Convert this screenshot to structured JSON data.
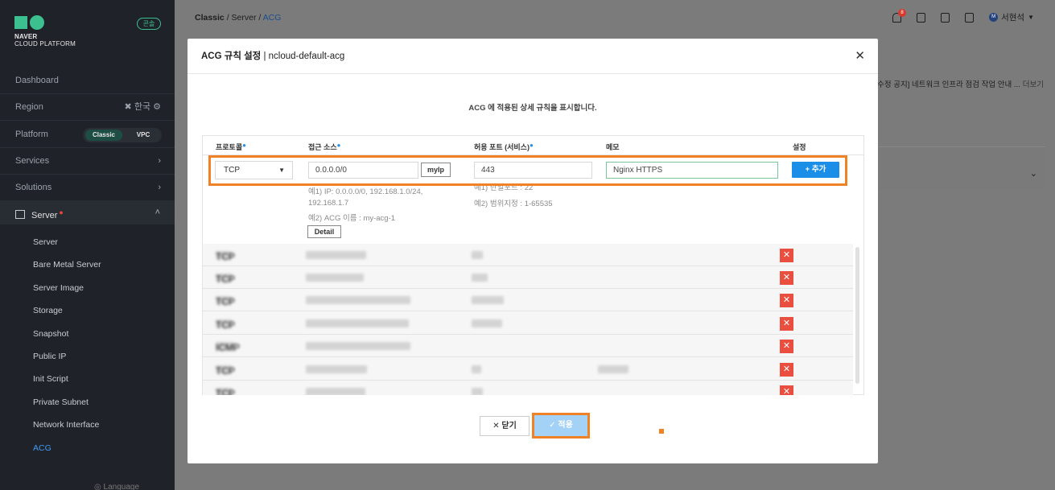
{
  "sidebar": {
    "brand_line1": "NAVER",
    "brand_line2": "CLOUD PLATFORM",
    "badge": "콘솔",
    "dashboard": "Dashboard",
    "region_label": "Region",
    "region_value": "한국",
    "platform_label": "Platform",
    "platform_options": [
      "Classic",
      "VPC"
    ],
    "services": "Services",
    "solutions": "Solutions",
    "server_section": "Server",
    "server_items": [
      "Server",
      "Bare Metal Server",
      "Server Image",
      "Storage",
      "Snapshot",
      "Public IP",
      "Init Script",
      "Private Subnet",
      "Network Interface",
      "ACG"
    ],
    "active_item": "ACG",
    "language": "Language"
  },
  "header": {
    "breadcrumb": [
      "Classic",
      "Server",
      "ACG"
    ],
    "notification_count": "8",
    "user_initial": "M",
    "user_name": "서현석",
    "notice_text": "[수정 공지] 네트워크 인프라 점검 작업 안내 ...",
    "notice_more": "더보기"
  },
  "modal": {
    "title_bold": "ACG 규칙 설정",
    "title_rest": "| ncloud-default-acg",
    "subtitle": "ACG 에 적용된 상세 규칙을 표시합니다.",
    "columns": [
      "프로토콜",
      "접근 소스",
      "허용 포트 (서비스)",
      "메모",
      "설정"
    ],
    "form": {
      "protocol": "TCP",
      "source": "0.0.0.0/0",
      "myip_label": "myIp",
      "port": "443",
      "memo": "Nginx HTTPS",
      "add_label": "+ 추가",
      "source_hint1": "예1) IP: 0.0.0.0/0, 192.168.1.0/24,",
      "source_hint2": "192.168.1.7",
      "source_hint3": "예2) ACG 이름 : my-acg-1",
      "detail_label": "Detail",
      "port_hint1": "예1) 단일포트 : 22",
      "port_hint2": "예2) 범위지정 : 1-65535"
    },
    "rules": [
      {
        "protocol": "TCP"
      },
      {
        "protocol": "TCP"
      },
      {
        "protocol": "TCP"
      },
      {
        "protocol": "TCP"
      },
      {
        "protocol": "ICMP"
      },
      {
        "protocol": "TCP"
      },
      {
        "protocol": "TCP"
      }
    ],
    "close_label": "✕ 닫기",
    "apply_label": "✓ 적용"
  },
  "colors": {
    "accent_orange": "#f08125",
    "primary_blue": "#1b8ee7",
    "delete_red": "#e94e3f",
    "brand_green": "#3cc08f"
  }
}
